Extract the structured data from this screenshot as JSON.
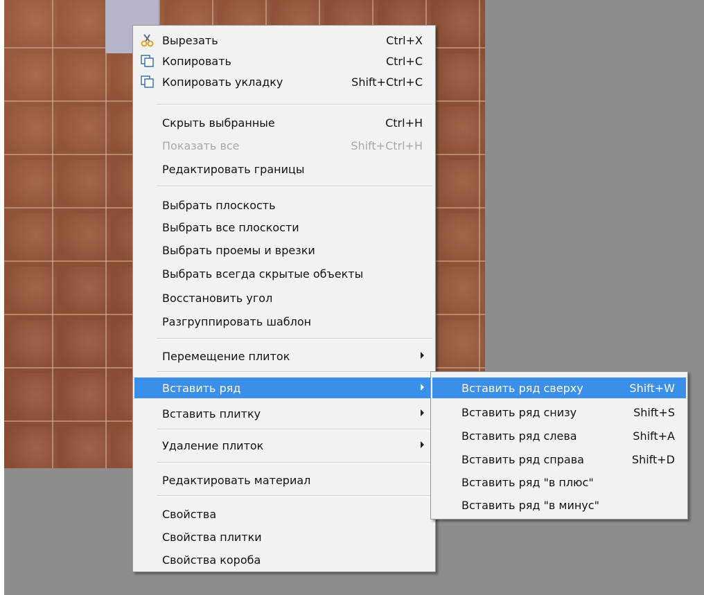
{
  "menu": {
    "items": [
      {
        "label": "Вырезать",
        "shortcut": "Ctrl+X",
        "icon": "scissors-icon"
      },
      {
        "label": "Копировать",
        "shortcut": "Ctrl+C",
        "icon": "copy-icon"
      },
      {
        "label": "Копировать укладку",
        "shortcut": "Shift+Ctrl+C",
        "icon": "copy-layout-icon"
      },
      {
        "label": "Скрыть выбранные",
        "shortcut": "Ctrl+H"
      },
      {
        "label": "Показать все",
        "shortcut": "Shift+Ctrl+H",
        "disabled": true
      },
      {
        "label": "Редактировать границы",
        "shortcut": ""
      },
      {
        "label": "Выбрать плоскость",
        "shortcut": ""
      },
      {
        "label": "Выбрать все плоскости",
        "shortcut": ""
      },
      {
        "label": "Выбрать проемы и врезки",
        "shortcut": ""
      },
      {
        "label": "Выбрать всегда скрытые объекты",
        "shortcut": ""
      },
      {
        "label": "Восстановить угол",
        "shortcut": ""
      },
      {
        "label": "Разгруппировать шаблон",
        "shortcut": ""
      },
      {
        "label": "Перемещение плиток",
        "submenu": true
      },
      {
        "label": "Вставить ряд",
        "submenu": true,
        "highlighted": true
      },
      {
        "label": "Вставить плитку",
        "submenu": true
      },
      {
        "label": "Удаление плиток",
        "submenu": true
      },
      {
        "label": "Редактировать материал",
        "shortcut": ""
      },
      {
        "label": "Свойства",
        "shortcut": ""
      },
      {
        "label": "Свойства плитки",
        "shortcut": ""
      },
      {
        "label": "Свойства короба",
        "shortcut": ""
      }
    ]
  },
  "submenu": {
    "items": [
      {
        "label": "Вставить ряд сверху",
        "shortcut": "Shift+W",
        "highlighted": true
      },
      {
        "label": "Вставить ряд снизу",
        "shortcut": "Shift+S"
      },
      {
        "label": "Вставить ряд слева",
        "shortcut": "Shift+A"
      },
      {
        "label": "Вставить ряд справа",
        "shortcut": "Shift+D"
      },
      {
        "label": "Вставить ряд \"в плюс\"",
        "shortcut": ""
      },
      {
        "label": "Вставить ряд \"в минус\"",
        "shortcut": ""
      }
    ]
  },
  "colors": {
    "highlight": "#3a90e8",
    "menu_bg": "#f2f2f2",
    "tile": "#8c5236",
    "viewport_bg": "#8d8d8d",
    "disabled_text": "#a8a8a8"
  }
}
